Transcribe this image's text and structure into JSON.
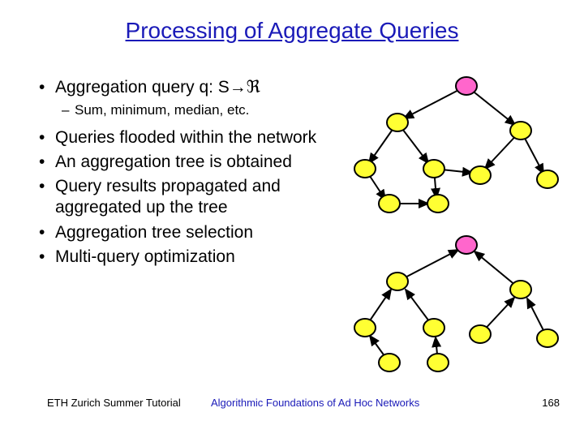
{
  "title": "Processing of Aggregate Queries",
  "bullets": {
    "b1": "Aggregation query q: S→ℜ",
    "b1_sub": "Sum, minimum, median, etc.",
    "b2": "Queries flooded within the network",
    "b3": "An aggregation tree is obtained",
    "b4": "Query results propagated and aggregated up the tree",
    "b5": "Aggregation tree selection",
    "b6": "Multi-query optimization"
  },
  "footer": {
    "left": "ETH Zurich Summer Tutorial",
    "center": "Algorithmic Foundations of Ad Hoc Networks",
    "page": "168"
  }
}
